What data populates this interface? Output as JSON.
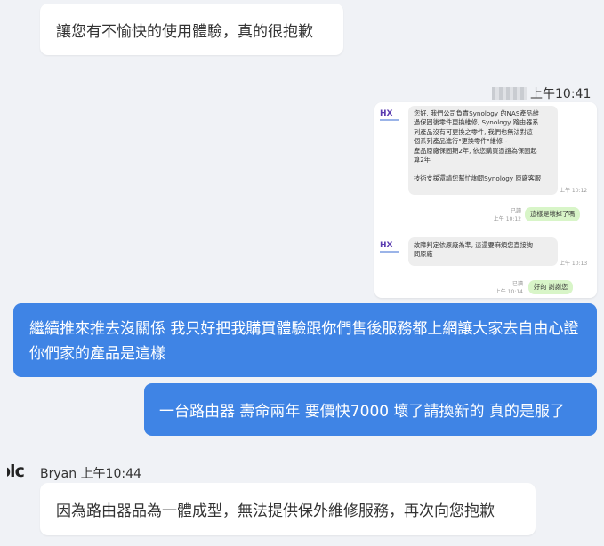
{
  "messages": {
    "m1": "讓您有不愉快的使用體驗，真的很抱歉",
    "time_top": "上午10:41",
    "m3": "繼續推來推去沒關係 我只好把我購買體驗跟你們售後服務都上網讓大家去自由心證 你們家的產品是這樣",
    "m4": "一台路由器 壽命兩年 要價快7000 壞了請換新的 真的是服了",
    "sender_name": "Bryan",
    "sender_time": "上午10:44",
    "avatar_text": "olc",
    "m5": "因為路由器品為一體成型，無法提供保外維修服務，再次向您抱歉"
  },
  "screenshot": {
    "msg_a": "您好, 我們公司負責Synology 的NAS產品維\n過保固後零件更換維修, Synology 路由器系\n列產品沒有可更換之零件, 我們也無法對這\n個系列產品進行\"更換零件\"維修~\n產品原廠保固期2年, 依您購買憑證為保固起\n算2年\n\n技術支援還請您幫忙詢問Synology 原廠客服",
    "time_a": "上午 10:12",
    "read_b": "已讀",
    "time_b": "上午 10:12",
    "msg_b": "這樣是壞掉了嗎",
    "msg_c": "故障判定依原廠為準, 這還要麻煩您直接詢\n問原廠",
    "time_c": "上午 10:13",
    "read_d": "已讀",
    "time_d": "上午 10:14",
    "msg_d": "好的 謝謝您"
  },
  "colors": {
    "background": "#f0f2f6",
    "outgoing_bubble": "#3f84e5",
    "incoming_bubble": "#ffffff",
    "screenshot_sent_bubble": "#d8f5c8"
  }
}
